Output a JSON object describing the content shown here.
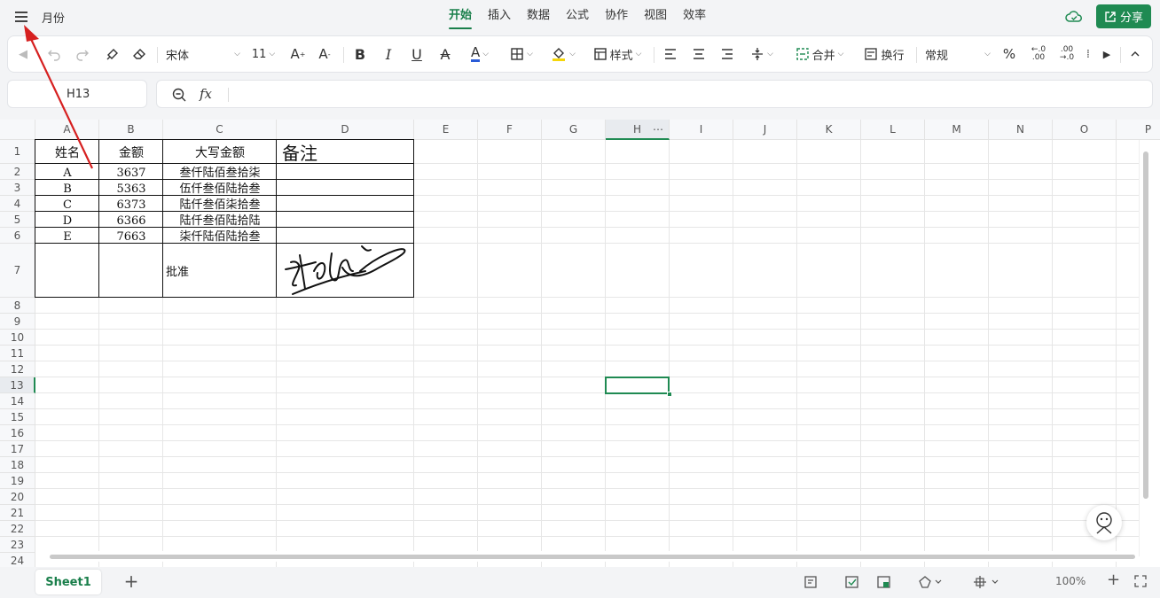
{
  "file": {
    "name": "月份"
  },
  "tabs": [
    "开始",
    "插入",
    "数据",
    "公式",
    "协作",
    "视图",
    "效率"
  ],
  "active_tab": "开始",
  "share_label": "分享",
  "toolbar": {
    "font_name": "宋体",
    "font_size": "11",
    "style_label": "样式",
    "merge_label": "合并",
    "wrap_label": "换行",
    "number_format": "常规"
  },
  "namebox": {
    "value": "H13"
  },
  "formula": {
    "fx": "fx",
    "value": ""
  },
  "columns": [
    "A",
    "B",
    "C",
    "D",
    "E",
    "F",
    "G",
    "H",
    "I",
    "J",
    "K",
    "L",
    "M",
    "N",
    "O",
    "P"
  ],
  "rows": [
    "1",
    "2",
    "3",
    "4",
    "5",
    "6",
    "7",
    "8",
    "9",
    "10",
    "11",
    "12",
    "13",
    "14",
    "15",
    "16",
    "17",
    "18",
    "19",
    "20",
    "21",
    "22",
    "23",
    "24"
  ],
  "table": {
    "headers": [
      "姓名",
      "金额",
      "大写金额",
      "备注"
    ],
    "rows": [
      [
        "A",
        "3637",
        "叁仟陆佰叁拾柒",
        ""
      ],
      [
        "B",
        "5363",
        "伍仟叁佰陆拾叁",
        ""
      ],
      [
        "C",
        "6373",
        "陆仟叁佰柒拾叁",
        ""
      ],
      [
        "D",
        "6366",
        "陆仟叁佰陆拾陆",
        ""
      ],
      [
        "E",
        "7663",
        "柒仟陆佰陆拾叁",
        ""
      ]
    ],
    "approval_label": "批准"
  },
  "selected_cell": "H13",
  "sheet_tab": "Sheet1",
  "status": {
    "zoom": "100%"
  },
  "colors": {
    "accent": "#1f8a52",
    "arrow": "#d62020",
    "selection": "#1f8a52"
  }
}
